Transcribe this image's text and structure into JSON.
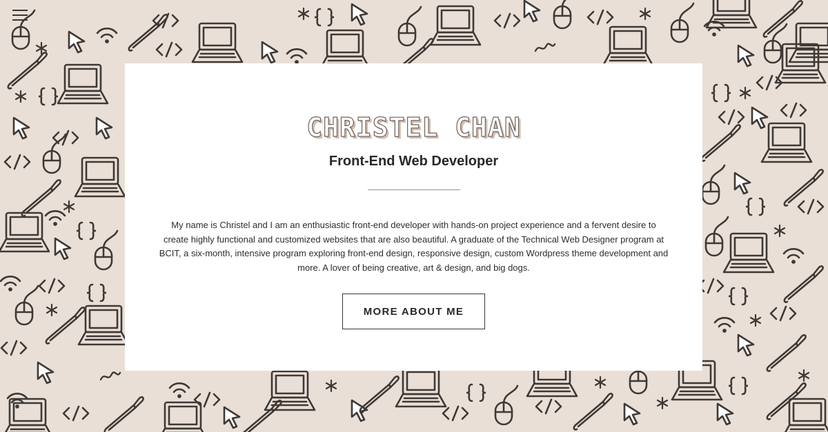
{
  "hero": {
    "name": "CHRISTEL CHAN",
    "title": "Front-End Web Developer",
    "bio": "My name is Christel and I am an enthusiastic front-end developer with hands-on project experience and a fervent desire to create highly functional and customized websites that are also beautiful. A graduate of the Technical Web Designer program at BCIT, a six-month, intensive program exploring front-end design, responsive design, custom Wordpress theme development and more. A lover of being creative, art & design, and big dogs.",
    "button_label": "MORE ABOUT ME"
  },
  "nav": {
    "menu_icon": "hamburger-menu-icon"
  },
  "background": {
    "pattern_icons": [
      "laptop-icon",
      "mouse-icon",
      "cursor-icon",
      "code-brackets-icon",
      "curly-braces-icon",
      "paintbrush-icon",
      "wifi-icon",
      "star-icon"
    ]
  },
  "colors": {
    "background": "#eadfd6",
    "card": "#ffffff",
    "ink": "#3a3634",
    "name_shadow": "#d9c5b8"
  }
}
